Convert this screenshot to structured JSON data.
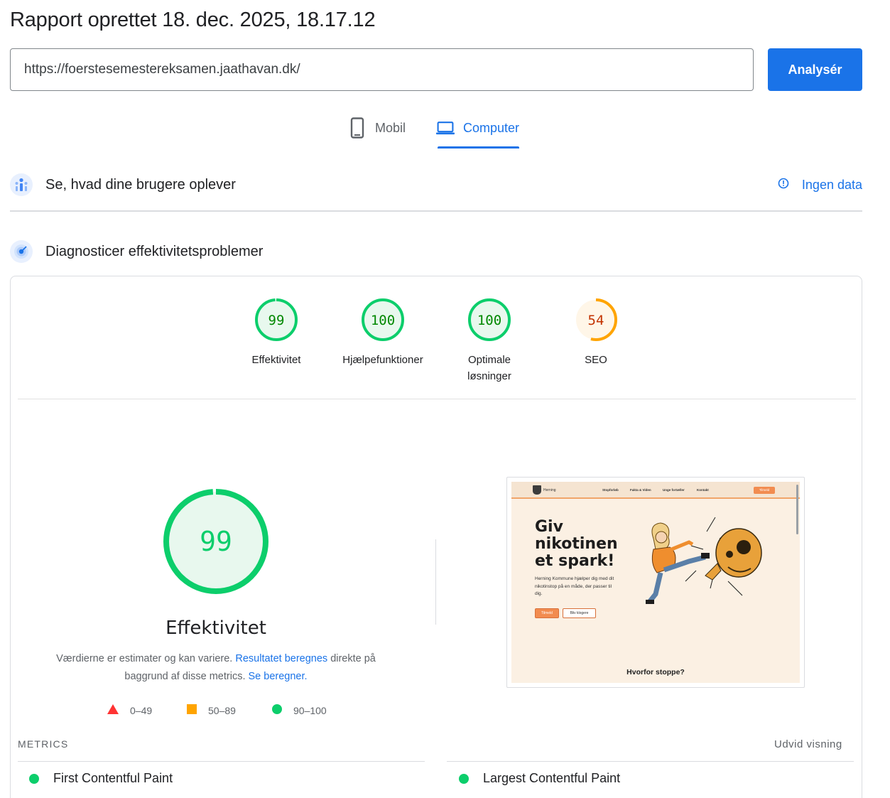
{
  "header": {
    "title": "Rapport oprettet 18. dec. 2025, 18.17.12"
  },
  "search": {
    "url_value": "https://foerstesemestereksamen.jaathavan.dk/",
    "analyze_label": "Analysér"
  },
  "device_tabs": [
    {
      "label": "Mobil",
      "icon": "smartphone-icon",
      "selected": false
    },
    {
      "label": "Computer",
      "icon": "laptop-icon",
      "selected": true
    }
  ],
  "field_data": {
    "title": "Se, hvad dine brugere oplever",
    "status_label": "Ingen data",
    "icon": "users-chart-icon"
  },
  "lab_data": {
    "title": "Diagnosticer effektivitetsproblemer",
    "icon": "gauge-icon"
  },
  "scores": [
    {
      "label": "Effektivitet",
      "value": 99,
      "color": "#0cce6b",
      "text_color": "#008800",
      "fill": "#e8f8ee"
    },
    {
      "label": "Hjælpefunktioner",
      "value": 100,
      "color": "#0cce6b",
      "text_color": "#008800",
      "fill": "#e8f8ee"
    },
    {
      "label": "Optimale løsninger",
      "value": 100,
      "color": "#0cce6b",
      "text_color": "#008800",
      "fill": "#e8f8ee"
    },
    {
      "label": "SEO",
      "value": 54,
      "color": "#ffa400",
      "text_color": "#c33300",
      "fill": "#fff6e8"
    }
  ],
  "main_score": {
    "value": 99,
    "label": "Effektivitet",
    "color": "#0cce6b",
    "description_prefix": "Værdierne er estimater og kan variere.",
    "link1": "Resultatet beregnes",
    "description_middle": "direkte på baggrund af disse metrics.",
    "link2": "Se beregner."
  },
  "legend": [
    {
      "shape": "triangle",
      "color": "#ff3333",
      "range": "0–49"
    },
    {
      "shape": "square",
      "color": "#ffa400",
      "range": "50–89"
    },
    {
      "shape": "circle",
      "color": "#0cce6b",
      "range": "90–100"
    }
  ],
  "screenshot": {
    "nav_logo": "Herning",
    "nav_links": [
      "Stopforløb",
      "Fakta & Viden",
      "Unge fortæller",
      "Kontakt"
    ],
    "nav_button": "Tilmeld",
    "heading_lines": [
      "Giv",
      "nikotinen",
      "et spark!"
    ],
    "subtext": "Herning Kommune hjælper dig med dit nikotinstop på en måde, der passer til dig.",
    "btn_primary": "Tilmeld",
    "btn_secondary": "Bliv klogere",
    "footer_heading": "Hvorfor stoppe?"
  },
  "metrics": {
    "header": "METRICS",
    "expand": "Udvid visning",
    "items": [
      {
        "name": "First Contentful Paint",
        "status_color": "#0cce6b"
      },
      {
        "name": "Largest Contentful Paint",
        "status_color": "#0cce6b"
      }
    ]
  }
}
